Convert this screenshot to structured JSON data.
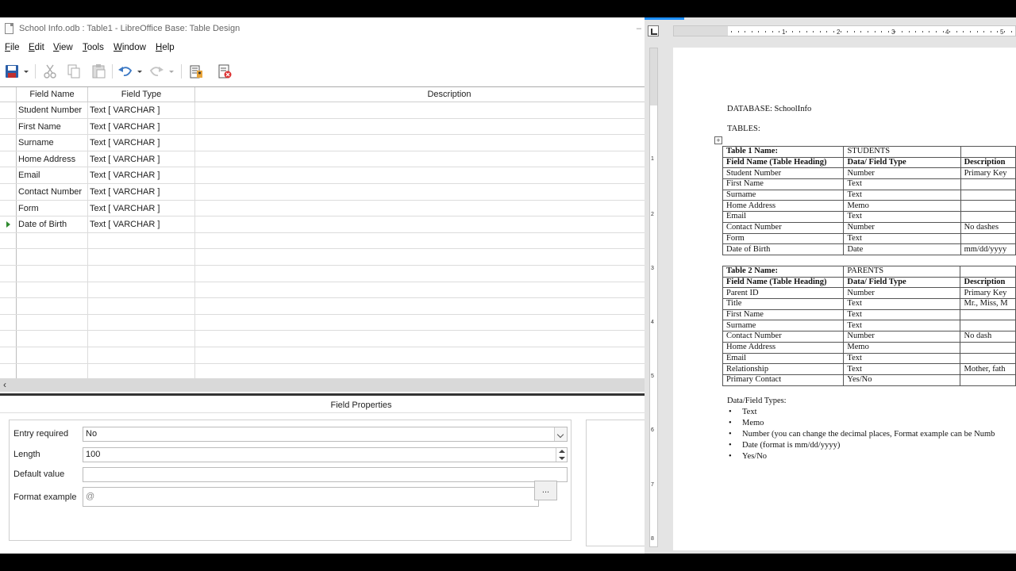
{
  "base": {
    "title": "School Info.odb : Table1 - LibreOffice Base: Table Design",
    "menu": [
      {
        "label": "File",
        "key": "F",
        "rest": "ile"
      },
      {
        "label": "Edit",
        "key": "E",
        "rest": "dit"
      },
      {
        "label": "View",
        "key": "V",
        "rest": "iew"
      },
      {
        "label": "Tools",
        "key": "T",
        "rest": "ools"
      },
      {
        "label": "Window",
        "key": "W",
        "rest": "indow"
      },
      {
        "label": "Help",
        "key": "H",
        "rest": "elp"
      }
    ],
    "toolbar_icons": [
      "save-icon",
      "dropdown-arrow-icon",
      "cut-icon",
      "copy-icon",
      "paste-icon",
      "undo-icon",
      "redo-icon",
      "primary-key-icon",
      "index-design-icon"
    ],
    "grid": {
      "columns": [
        "Field Name",
        "Field Type",
        "Description"
      ],
      "rows": [
        {
          "name": "Student Number",
          "type": "Text [ VARCHAR ]",
          "description": ""
        },
        {
          "name": "First Name",
          "type": "Text [ VARCHAR ]",
          "description": ""
        },
        {
          "name": "Surname",
          "type": "Text [ VARCHAR ]",
          "description": ""
        },
        {
          "name": "Home Address",
          "type": "Text [ VARCHAR ]",
          "description": ""
        },
        {
          "name": "Email",
          "type": "Text [ VARCHAR ]",
          "description": ""
        },
        {
          "name": "Contact Number",
          "type": "Text [ VARCHAR ]",
          "description": ""
        },
        {
          "name": "Form",
          "type": "Text [ VARCHAR ]",
          "description": ""
        },
        {
          "name": "Date of Birth",
          "type": "Text [ VARCHAR ]",
          "description": ""
        }
      ],
      "active_row": 7,
      "empty_rows": 9
    },
    "properties": {
      "title": "Field Properties",
      "entry_required_label": "Entry required",
      "entry_required_value": "No",
      "length_label": "Length",
      "length_value": "100",
      "default_value_label": "Default value",
      "default_value_value": "",
      "format_example_label": "Format example",
      "format_example_value": "@",
      "format_button": "..."
    }
  },
  "writer": {
    "ruler_numbers": [
      "1",
      "2",
      "3",
      "4",
      "5"
    ],
    "vruler_numbers": [
      "1",
      "2",
      "3",
      "4",
      "5",
      "6",
      "7",
      "8"
    ],
    "heading": "DATABASE: SchoolInfo",
    "tables_label": "TABLES:",
    "table1": {
      "name_label": "Table 1 Name:",
      "name_value": "STUDENTS",
      "header": [
        "Field Name (Table Heading)",
        "Data/ Field Type",
        "Description"
      ],
      "rows": [
        [
          "Student Number",
          "Number",
          "Primary Key"
        ],
        [
          "First Name",
          "Text",
          ""
        ],
        [
          "Surname",
          "Text",
          ""
        ],
        [
          "Home Address",
          "Memo",
          ""
        ],
        [
          "Email",
          "Text",
          ""
        ],
        [
          "Contact Number",
          "Number",
          "No dashes"
        ],
        [
          "Form",
          "Text",
          ""
        ],
        [
          "Date of Birth",
          "Date",
          "mm/dd/yyyy"
        ]
      ]
    },
    "table2": {
      "name_label": "Table 2 Name:",
      "name_value": "PARENTS",
      "header": [
        "Field Name (Table Heading)",
        "Data/ Field Type",
        "Description"
      ],
      "rows": [
        [
          "Parent ID",
          "Number",
          "Primary Key"
        ],
        [
          "Title",
          "Text",
          "Mr., Miss, M"
        ],
        [
          "First Name",
          "Text",
          ""
        ],
        [
          "Surname",
          "Text",
          ""
        ],
        [
          "Contact Number",
          "Number",
          "No dash"
        ],
        [
          "Home Address",
          "Memo",
          ""
        ],
        [
          "Email",
          "Text",
          ""
        ],
        [
          "Relationship",
          "Text",
          "Mother, fath"
        ],
        [
          "Primary Contact",
          "Yes/No",
          ""
        ]
      ]
    },
    "types_heading": "Data/Field Types:",
    "types": [
      "Text",
      "Memo",
      "Number (you can change the decimal places, Format example  can be Numb",
      "Date (format is mm/dd/yyyy)",
      "Yes/No"
    ]
  }
}
